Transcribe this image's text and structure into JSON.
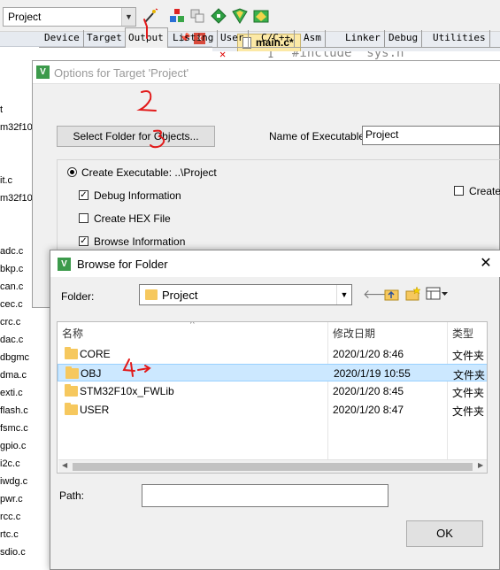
{
  "toolbar": {
    "target_value": "Project",
    "icons": [
      "magic-wand-icon",
      "manage-components-icon",
      "copy-icon",
      "diamond-icon",
      "shield-icon",
      "pack-icon"
    ]
  },
  "project_tree": {
    "files": [
      "t",
      "m32f10x",
      "",
      "it.c",
      "m32f10x",
      "",
      "",
      "adc.c",
      "bkp.c",
      "can.c",
      "cec.c",
      "crc.c",
      "dac.c",
      "dbgmc",
      "dma.c",
      "exti.c",
      "flash.c",
      "fsmc.c",
      "gpio.c",
      "i2c.c",
      "iwdg.c",
      "pwr.c",
      "rcc.c",
      "rtc.c",
      "sdio.c"
    ]
  },
  "editor": {
    "tab_label": "main.c*",
    "line_number": "1",
    "code": "#include \"sys.h\""
  },
  "options_dialog": {
    "title": "Options for Target 'Project'",
    "tabs": [
      "Device",
      "Target",
      "Output",
      "Listing",
      "User",
      "C/C++",
      "Asm",
      "Linker",
      "Debug",
      "Utilities"
    ],
    "active_tab": "Output",
    "select_folder_label": "Select Folder for Objects...",
    "name_exe_label": "Name of Executable:",
    "name_exe_value": "Project",
    "create_exe_label": "Create Executable:  ..\\Project",
    "debug_info_label": "Debug Information",
    "create_hex_label": "Create HEX File",
    "browse_info_label": "Browse Information",
    "create_right_label": "Create"
  },
  "browse_dialog": {
    "title": "Browse for Folder",
    "folder_label": "Folder:",
    "folder_value": "Project",
    "columns": {
      "name": "名称",
      "date": "修改日期",
      "type": "类型"
    },
    "rows": [
      {
        "name": "CORE",
        "date": "2020/1/20 8:46",
        "type": "文件夹"
      },
      {
        "name": "OBJ",
        "date": "2020/1/19 10:55",
        "type": "文件夹"
      },
      {
        "name": "STM32F10x_FWLib",
        "date": "2020/1/20 8:45",
        "type": "文件夹"
      },
      {
        "name": "USER",
        "date": "2020/1/20 8:47",
        "type": "文件夹"
      }
    ],
    "selected_row": "OBJ",
    "path_label": "Path:",
    "path_value": "",
    "ok_label": "OK"
  },
  "annotations": [
    "1",
    "2",
    "3",
    "4"
  ],
  "colors": {
    "selection": "#cce8ff",
    "folder": "#f6c85e",
    "annotation_red": "#e21a1a",
    "keil_green": "#3c9a4b"
  }
}
